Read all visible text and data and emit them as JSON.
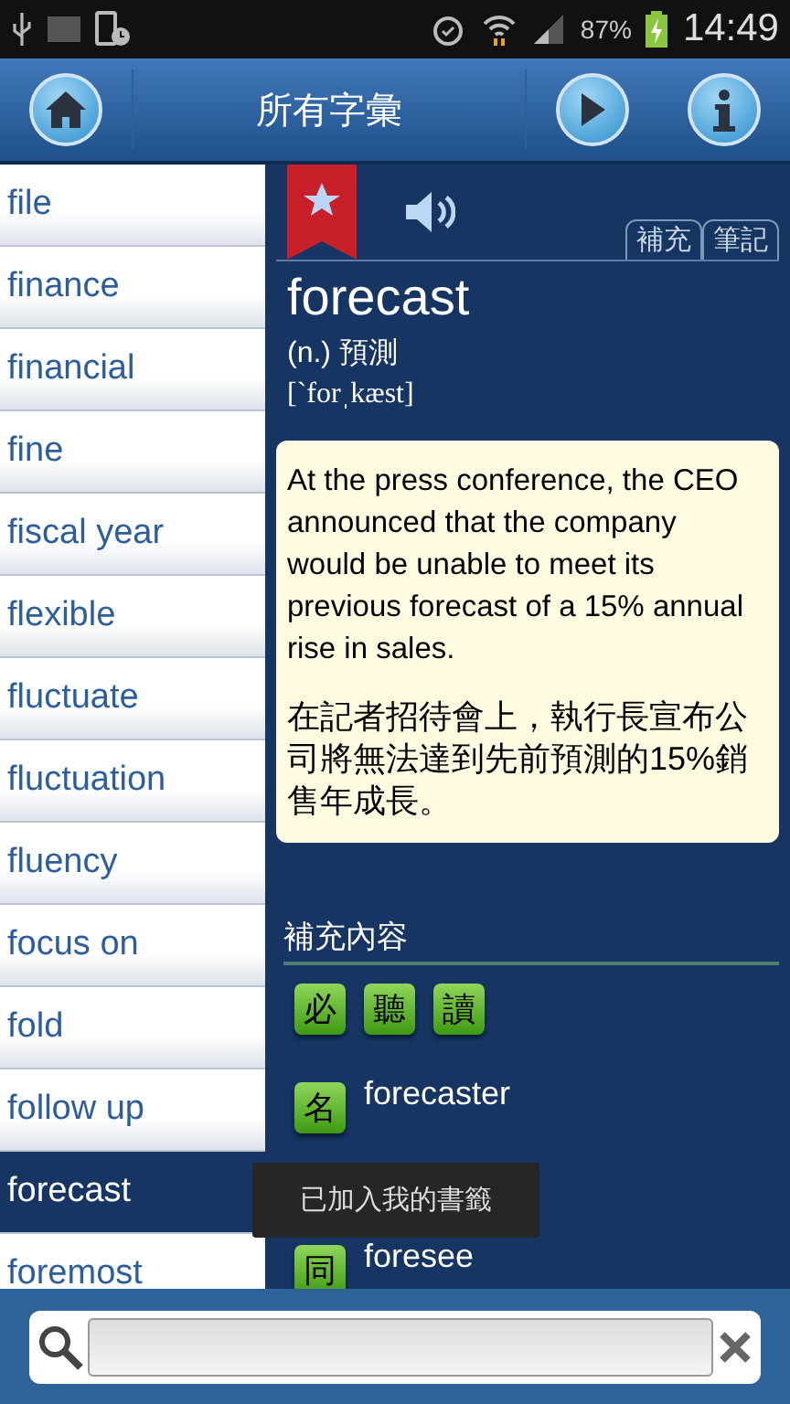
{
  "status_bar": {
    "battery_text": "87%",
    "time": "14:49"
  },
  "header": {
    "title": "所有字彙"
  },
  "word_list": [
    {
      "word": "file",
      "selected": false
    },
    {
      "word": "finance",
      "selected": false
    },
    {
      "word": "financial",
      "selected": false
    },
    {
      "word": "fine",
      "selected": false
    },
    {
      "word": "fiscal year",
      "selected": false
    },
    {
      "word": "flexible",
      "selected": false
    },
    {
      "word": "fluctuate",
      "selected": false
    },
    {
      "word": "fluctuation",
      "selected": false
    },
    {
      "word": "fluency",
      "selected": false
    },
    {
      "word": "focus on",
      "selected": false
    },
    {
      "word": "fold",
      "selected": false
    },
    {
      "word": "follow up",
      "selected": false
    },
    {
      "word": "forecast",
      "selected": true
    },
    {
      "word": "foremost",
      "selected": false
    }
  ],
  "entry": {
    "bookmarked": true,
    "tabs": [
      {
        "label": "補充",
        "selected": false
      },
      {
        "label": "筆記",
        "selected": false
      }
    ],
    "headword": "forecast",
    "definition": "(n.) 預測",
    "phonetic": "[`forˌkæst]",
    "example_en": "At the press conference, the CEO announced that the company would be unable to meet its previous forecast of a 15% annual rise in sales.",
    "example_zh": "在記者招待會上，執行長宣布公司將無法達到先前預測的15%銷售年成長。",
    "supplement_title": "補充內容",
    "tags": [
      "必",
      "聽",
      "讀"
    ],
    "related": [
      {
        "badge": "名",
        "word": "forecaster"
      },
      {
        "badge": "同",
        "word": "foresee"
      }
    ]
  },
  "toast": "已加入我的書籤"
}
